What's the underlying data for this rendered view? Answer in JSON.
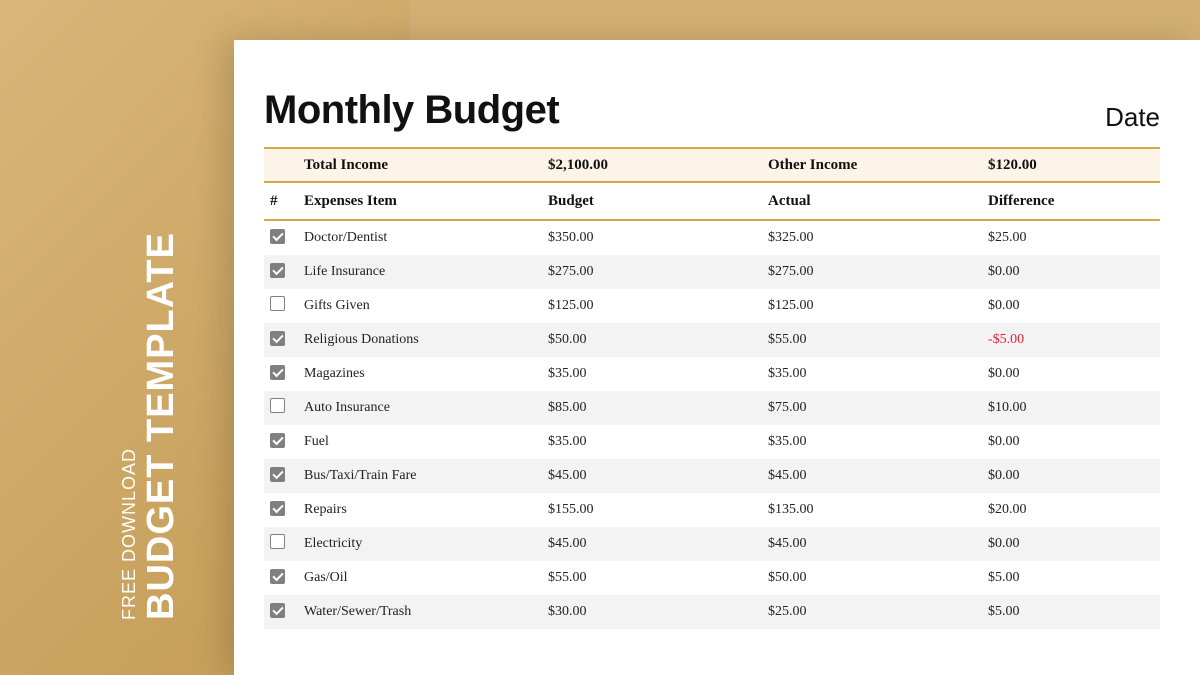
{
  "sidebar": {
    "line1": "FREE DOWNLOAD",
    "line2": "BUDGET TEMPLATE"
  },
  "doc": {
    "title": "Monthly Budget",
    "date_label": "Date"
  },
  "income": {
    "total_label": "Total Income",
    "total_value": "$2,100.00",
    "other_label": "Other Income",
    "other_value": "$120.00"
  },
  "columns": {
    "hash": "#",
    "item": "Expenses Item",
    "budget": "Budget",
    "actual": "Actual",
    "difference": "Difference"
  },
  "rows": [
    {
      "checked": true,
      "item": "Doctor/Dentist",
      "budget": "$350.00",
      "actual": "$325.00",
      "difference": "$25.00",
      "neg": false
    },
    {
      "checked": true,
      "item": "Life Insurance",
      "budget": "$275.00",
      "actual": "$275.00",
      "difference": "$0.00",
      "neg": false
    },
    {
      "checked": false,
      "item": "Gifts Given",
      "budget": "$125.00",
      "actual": "$125.00",
      "difference": "$0.00",
      "neg": false
    },
    {
      "checked": true,
      "item": "Religious Donations",
      "budget": "$50.00",
      "actual": "$55.00",
      "difference": "-$5.00",
      "neg": true
    },
    {
      "checked": true,
      "item": "Magazines",
      "budget": "$35.00",
      "actual": "$35.00",
      "difference": "$0.00",
      "neg": false
    },
    {
      "checked": false,
      "item": "Auto Insurance",
      "budget": "$85.00",
      "actual": "$75.00",
      "difference": "$10.00",
      "neg": false
    },
    {
      "checked": true,
      "item": "Fuel",
      "budget": "$35.00",
      "actual": "$35.00",
      "difference": "$0.00",
      "neg": false
    },
    {
      "checked": true,
      "item": "Bus/Taxi/Train Fare",
      "budget": "$45.00",
      "actual": "$45.00",
      "difference": "$0.00",
      "neg": false
    },
    {
      "checked": true,
      "item": "Repairs",
      "budget": "$155.00",
      "actual": "$135.00",
      "difference": "$20.00",
      "neg": false
    },
    {
      "checked": false,
      "item": "Electricity",
      "budget": "$45.00",
      "actual": "$45.00",
      "difference": "$0.00",
      "neg": false
    },
    {
      "checked": true,
      "item": "Gas/Oil",
      "budget": "$55.00",
      "actual": "$50.00",
      "difference": "$5.00",
      "neg": false
    },
    {
      "checked": true,
      "item": "Water/Sewer/Trash",
      "budget": "$30.00",
      "actual": "$25.00",
      "difference": "$5.00",
      "neg": false
    }
  ]
}
